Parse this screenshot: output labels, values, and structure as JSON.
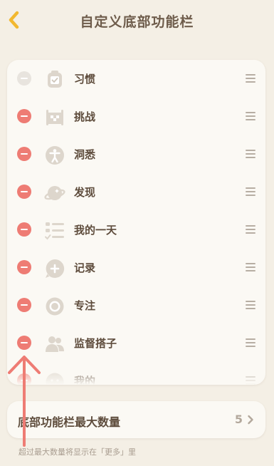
{
  "header": {
    "title": "自定义底部功能栏"
  },
  "items": [
    {
      "label": "习惯",
      "icon": "habit-icon",
      "removable": false
    },
    {
      "label": "挑战",
      "icon": "challenge-icon",
      "removable": true
    },
    {
      "label": "洞悉",
      "icon": "insight-icon",
      "removable": true
    },
    {
      "label": "发现",
      "icon": "discover-icon",
      "removable": true
    },
    {
      "label": "我的一天",
      "icon": "my-day-icon",
      "removable": true
    },
    {
      "label": "记录",
      "icon": "record-icon",
      "removable": true
    },
    {
      "label": "专注",
      "icon": "focus-icon",
      "removable": true
    },
    {
      "label": "监督搭子",
      "icon": "supervision-buddy-icon",
      "removable": true
    },
    {
      "label": "我的",
      "icon": "profile-icon",
      "removable": true
    }
  ],
  "max_setting": {
    "label": "底部功能栏最大数量",
    "value": "5"
  },
  "hint": "超过最大数量将显示在「更多」里",
  "colors": {
    "remove": "#ee7c74",
    "back_arrow": "#f2b830",
    "annotation_arrow": "#ee7c74"
  }
}
